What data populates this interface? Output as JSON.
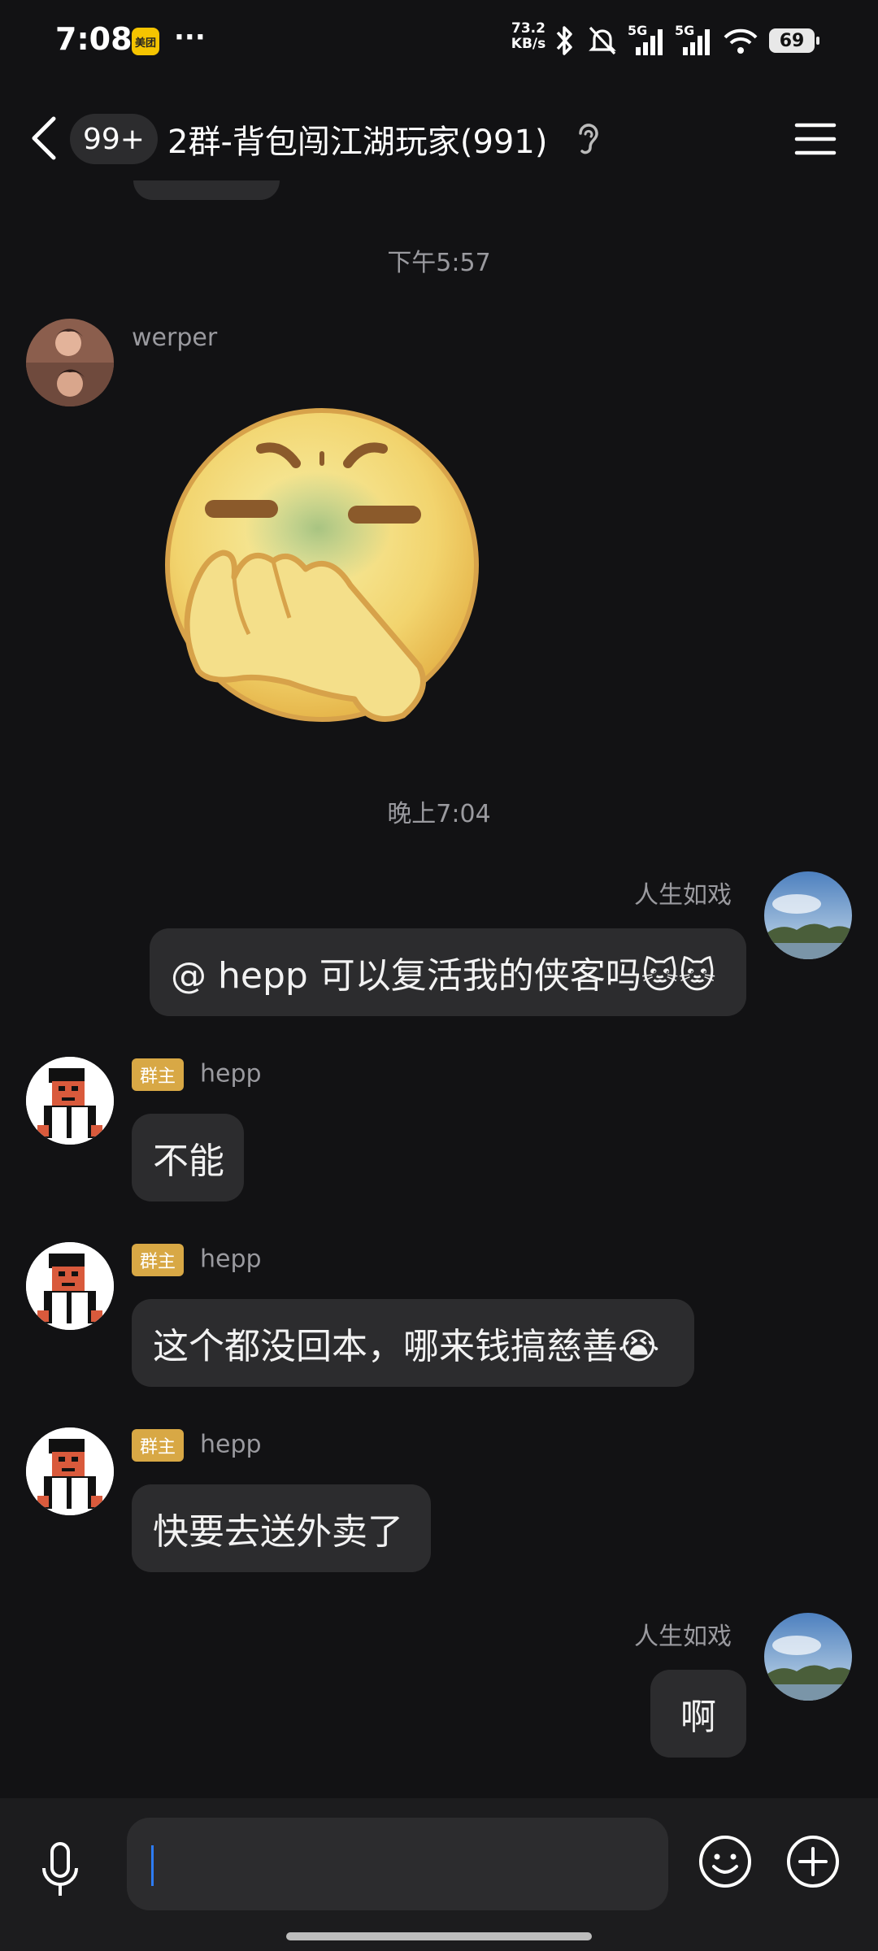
{
  "status_bar": {
    "time": "7:08",
    "meituan_label": "美团",
    "more_dots": "···",
    "net_speed_value": "73.2",
    "net_speed_unit": "KB/s",
    "signal_1_label": "5G",
    "signal_2_label": "5G",
    "battery": "69"
  },
  "header": {
    "unread_count": "99+",
    "title": "2群-背包闯江湖玩家(991)"
  },
  "messages": {
    "ts1": "下午5:57",
    "m1_name": "werper",
    "ts2": "晚上7:04",
    "m2_name": "人生如戏",
    "m2_text": "@ hepp 可以复活我的侠客吗🐱🐱",
    "owner_badge": "群主",
    "m3_name": "hepp",
    "m3_text": "不能",
    "m4_name": "hepp",
    "m4_text": "这个都没回本，哪来钱搞慈善😭",
    "m5_name": "hepp",
    "m5_text": "快要去送外卖了",
    "m6_name": "人生如戏",
    "m6_text": "啊"
  },
  "input": {
    "value": ""
  },
  "colors": {
    "background": "#121214",
    "bubble": "#2c2c2e",
    "owner_badge": "#d8a845",
    "cursor": "#2d7cf6"
  }
}
